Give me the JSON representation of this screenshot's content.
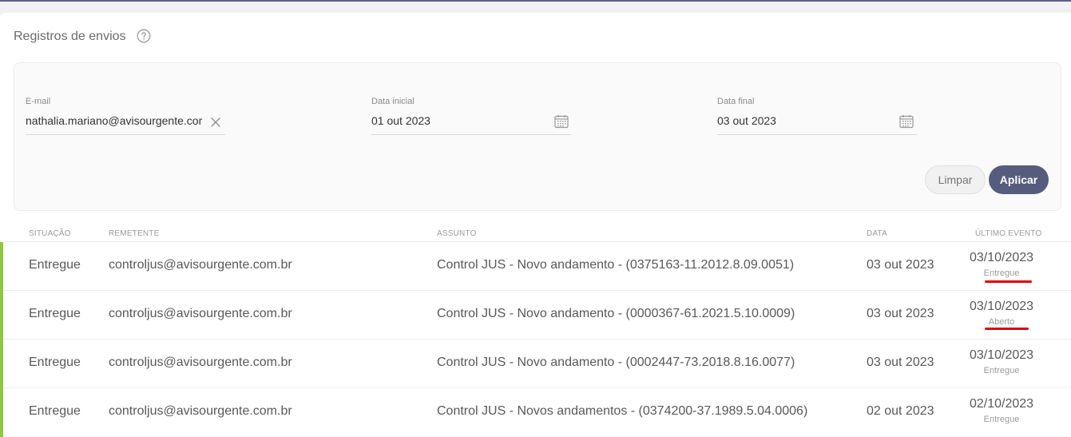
{
  "page": {
    "title": "Registros de envios",
    "help_icon": "question-circle-icon"
  },
  "filters": {
    "email": {
      "label": "E-mail",
      "value": "nathalia.mariano@avisourgente.cor",
      "clear_icon": "close-icon"
    },
    "start_date": {
      "label": "Data inicial",
      "value": "01 out 2023",
      "icon": "calendar-icon"
    },
    "end_date": {
      "label": "Data final",
      "value": "03 out 2023",
      "icon": "calendar-icon"
    },
    "clear_label": "Limpar",
    "apply_label": "Aplicar"
  },
  "table": {
    "columns": [
      "SITUAÇÃO",
      "REMETENTE",
      "ASSUNTO",
      "DATA",
      "ÚLTIMO EVENTO"
    ],
    "rows": [
      {
        "status": "Entregue",
        "sender": "controljus@avisourgente.com.br",
        "subject": "Control JUS - Novo andamento - (0375163-11.2012.8.09.0051)",
        "date": "03 out 2023",
        "event_date": "03/10/2023",
        "event_status": "Entregue"
      },
      {
        "status": "Entregue",
        "sender": "controljus@avisourgente.com.br",
        "subject": "Control JUS - Novo andamento - (0000367-61.2021.5.10.0009)",
        "date": "03 out 2023",
        "event_date": "03/10/2023",
        "event_status": "Aberto"
      },
      {
        "status": "Entregue",
        "sender": "controljus@avisourgente.com.br",
        "subject": "Control JUS - Novo andamento - (0002447-73.2018.8.16.0077)",
        "date": "03 out 2023",
        "event_date": "03/10/2023",
        "event_status": "Entregue"
      },
      {
        "status": "Entregue",
        "sender": "controljus@avisourgente.com.br",
        "subject": "Control JUS - Novos andamentos - (0374200-37.1989.5.04.0006)",
        "date": "02 out 2023",
        "event_date": "02/10/2023",
        "event_status": "Entregue"
      }
    ]
  },
  "colors": {
    "accent": "#565c7d",
    "status_bar": "#8dc63f",
    "annotation": "#e00000"
  }
}
